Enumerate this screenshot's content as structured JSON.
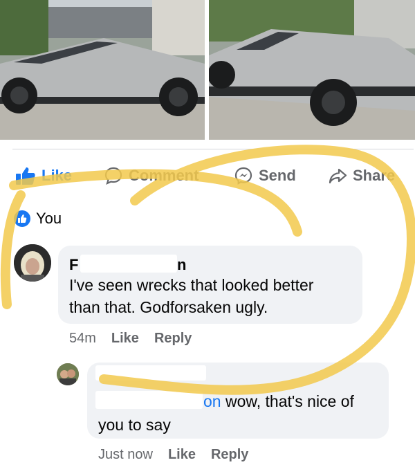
{
  "actions": {
    "like": "Like",
    "comment": "Comment",
    "send": "Send",
    "share": "Share"
  },
  "reactions": {
    "name": "You"
  },
  "comments": [
    {
      "author_prefix": "F",
      "author_suffix": "n",
      "text_line1": "I've seen wrecks that looked better",
      "text_line2": "than that. Godforsaken ugly.",
      "time": "54m",
      "like": "Like",
      "reply": "Reply"
    },
    {
      "mention_suffix": "on",
      "text_rest": " wow, that's nice of",
      "text_line2": "you to say",
      "time": "Just now",
      "like": "Like",
      "reply": "Reply"
    }
  ],
  "colors": {
    "accent": "#1877f2",
    "highlight": "#f2c94c",
    "bubble": "#f0f2f5",
    "muted": "#65676b"
  }
}
